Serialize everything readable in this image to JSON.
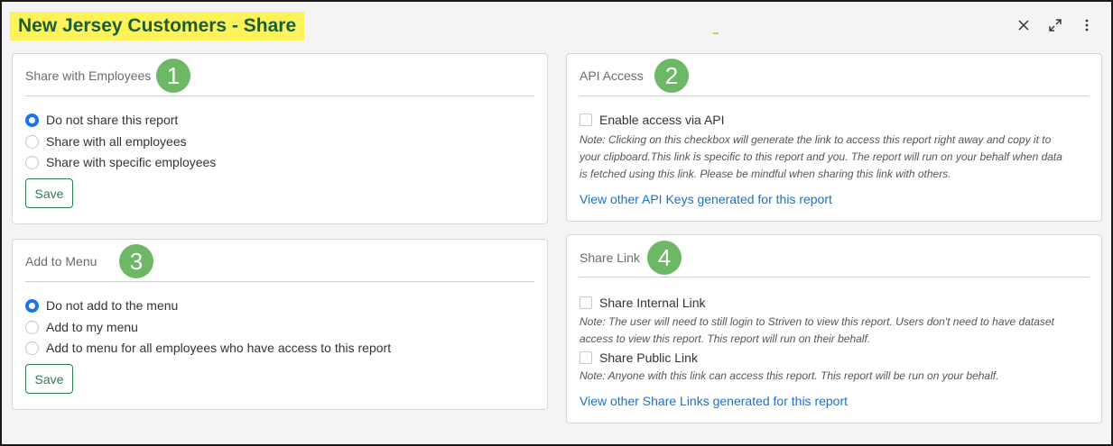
{
  "header": {
    "title": "New Jersey Customers - Share",
    "close_icon": "close-icon",
    "expand_icon": "expand-icon",
    "more_icon": "more-vertical-icon"
  },
  "share_employees": {
    "title": "Share with Employees",
    "badge": "1",
    "options": [
      {
        "label": "Do not share this report",
        "selected": true
      },
      {
        "label": "Share with all employees",
        "selected": false
      },
      {
        "label": "Share with specific employees",
        "selected": false
      }
    ],
    "save_label": "Save"
  },
  "add_menu": {
    "title": "Add to Menu",
    "badge": "3",
    "options": [
      {
        "label": "Do not add to the menu",
        "selected": true
      },
      {
        "label": "Add to my menu",
        "selected": false
      },
      {
        "label": "Add to menu for all employees who have access to this report",
        "selected": false
      }
    ],
    "save_label": "Save"
  },
  "api_access": {
    "title": "API Access",
    "badge": "2",
    "checkbox_label": "Enable access via API",
    "note_lines": [
      "Note: Clicking on this checkbox will generate the link to access this report right away and copy it to",
      "your clipboard.This link is specific to this report and you. The report will run on your behalf when data",
      "is fetched using this link. Please be mindful when sharing this link with others."
    ],
    "link": "View other API Keys generated for this report"
  },
  "share_link": {
    "title": "Share Link",
    "badge": "4",
    "internal_label": "Share Internal Link",
    "internal_note_lines": [
      "Note: The user will need to still login to Striven to view this report. Users don't need to have dataset",
      "access to view this report. This report will run on their behalf."
    ],
    "public_label": "Share Public Link",
    "public_note": "Note: Anyone with this link can access this report. This report will be run on your behalf.",
    "link": "View other Share Links generated for this report"
  },
  "colors": {
    "title_highlight": "#fdf25a",
    "title_text": "#1b5e35",
    "badge": "#6db865",
    "radio_selected": "#1a73e8",
    "link": "#1a6fd6",
    "save_button": "#2e7d4f"
  }
}
